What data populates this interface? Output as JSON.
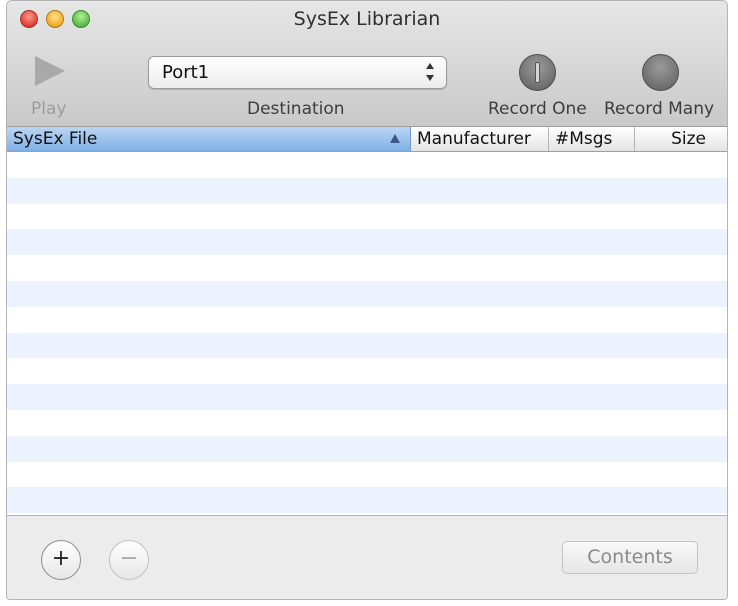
{
  "window": {
    "title": "SysEx Librarian"
  },
  "toolbar": {
    "play_label": "Play",
    "destination": {
      "label": "Destination",
      "selected": "Port1"
    },
    "record_one_label": "Record One",
    "record_many_label": "Record Many"
  },
  "table": {
    "columns": [
      "SysEx File",
      "Manufacturer",
      "#Msgs",
      "Size"
    ],
    "sorted_column": "SysEx File",
    "sort_direction": "ascending",
    "rows": []
  },
  "footer": {
    "add_symbol": "+",
    "remove_symbol": "−",
    "contents_label": "Contents"
  },
  "colors": {
    "header_selected": "#8fbbe9",
    "row_alternate": "#edf3fe",
    "close": "#e0443a",
    "minimize": "#f2b02a",
    "zoom": "#5fc04a"
  }
}
